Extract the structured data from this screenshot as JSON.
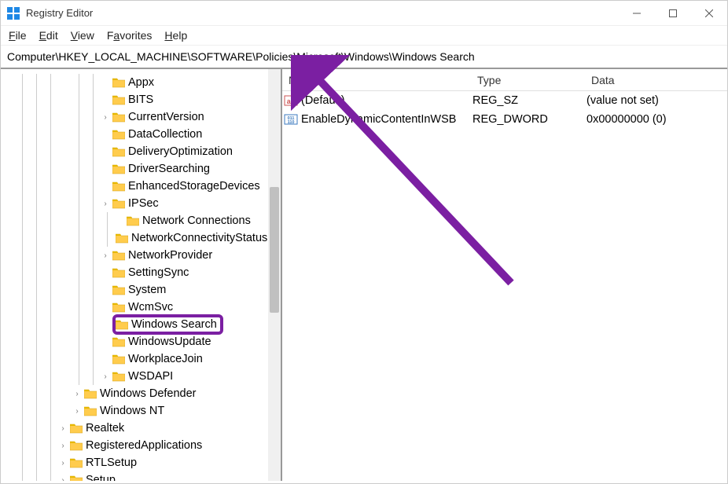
{
  "window": {
    "title": "Registry Editor"
  },
  "menu": {
    "file": "File",
    "edit": "Edit",
    "view": "View",
    "favorites": "Favorites",
    "help": "Help"
  },
  "address": "Computer\\HKEY_LOCAL_MACHINE\\SOFTWARE\\Policies\\Microsoft\\Windows\\Windows Search",
  "tree": [
    {
      "depth": 7,
      "expander": "",
      "label": "Appx"
    },
    {
      "depth": 7,
      "expander": "",
      "label": "BITS"
    },
    {
      "depth": 7,
      "expander": ">",
      "label": "CurrentVersion"
    },
    {
      "depth": 7,
      "expander": "",
      "label": "DataCollection"
    },
    {
      "depth": 7,
      "expander": "",
      "label": "DeliveryOptimization"
    },
    {
      "depth": 7,
      "expander": "",
      "label": "DriverSearching"
    },
    {
      "depth": 7,
      "expander": "",
      "label": "EnhancedStorageDevices"
    },
    {
      "depth": 7,
      "expander": ">",
      "label": "IPSec"
    },
    {
      "depth": 8,
      "expander": "",
      "label": "Network Connections"
    },
    {
      "depth": 8,
      "expander": "",
      "label": "NetworkConnectivityStatusIndicator"
    },
    {
      "depth": 7,
      "expander": ">",
      "label": "NetworkProvider"
    },
    {
      "depth": 7,
      "expander": "",
      "label": "SettingSync"
    },
    {
      "depth": 7,
      "expander": "",
      "label": "System"
    },
    {
      "depth": 7,
      "expander": "",
      "label": "WcmSvc"
    },
    {
      "depth": 7,
      "expander": "",
      "label": "Windows Search",
      "highlighted": true
    },
    {
      "depth": 7,
      "expander": "",
      "label": "WindowsUpdate"
    },
    {
      "depth": 7,
      "expander": "",
      "label": "WorkplaceJoin"
    },
    {
      "depth": 7,
      "expander": ">",
      "label": "WSDAPI"
    },
    {
      "depth": 5,
      "expander": ">",
      "label": "Windows Defender"
    },
    {
      "depth": 5,
      "expander": ">",
      "label": "Windows NT"
    },
    {
      "depth": 4,
      "expander": ">",
      "label": "Realtek"
    },
    {
      "depth": 4,
      "expander": ">",
      "label": "RegisteredApplications"
    },
    {
      "depth": 4,
      "expander": ">",
      "label": "RTLSetup"
    },
    {
      "depth": 4,
      "expander": ">",
      "label": "Setup"
    }
  ],
  "list": {
    "headers": {
      "name": "Name",
      "type": "Type",
      "data": "Data"
    },
    "rows": [
      {
        "icon": "string",
        "name": "(Default)",
        "type": "REG_SZ",
        "data": "(value not set)"
      },
      {
        "icon": "binary",
        "name": "EnableDynamicContentInWSB",
        "type": "REG_DWORD",
        "data": "0x00000000 (0)"
      }
    ]
  },
  "guide_levels": [
    1,
    2,
    3,
    5,
    6,
    7
  ]
}
